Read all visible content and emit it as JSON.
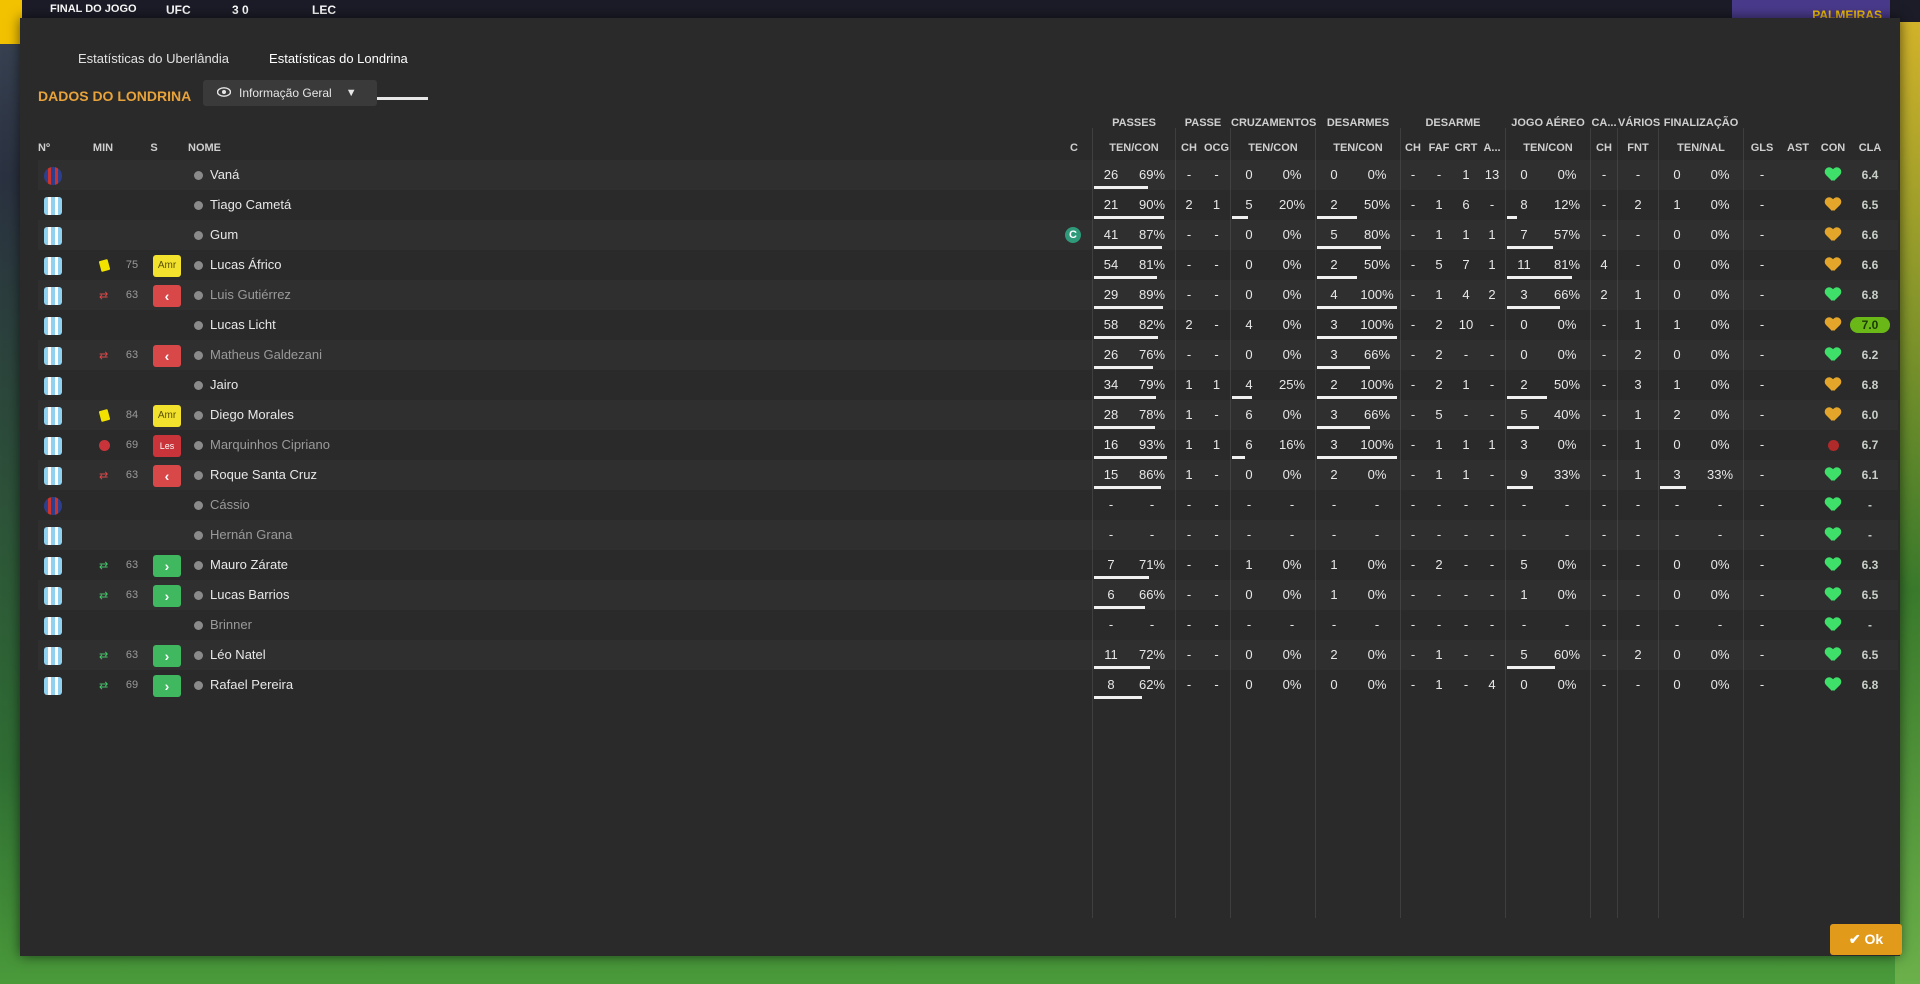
{
  "scorebar": {
    "final": "FINAL DO JOGO",
    "team_a": "UFC",
    "score": "3 0",
    "team_b": "LEC",
    "right_label": "PALMEIRAS"
  },
  "tabs": [
    "Estatísticas do Uberlândia",
    "Estatísticas do Londrina"
  ],
  "active_tab": 1,
  "section_title": "DADOS DO LONDRINA",
  "view_select": {
    "label": "Informação Geral",
    "icon": "eye-icon"
  },
  "groups": {
    "passes": "PASSES",
    "passe": "PASSE",
    "cruzamentos": "CRUZAMENTOS",
    "desarmes": "DESARMES",
    "desarme": "DESARME",
    "jogo_aereo": "JOGO AÉREO",
    "ca": "CA...",
    "varios": "VÁRIOS",
    "finalizacao": "FINALIZAÇÃO"
  },
  "headers": {
    "num": "Nº",
    "min": "MIN",
    "s": "S",
    "name": "NOME",
    "c": "C",
    "pass_tc": "TEN/CON",
    "passe_ch": "CH",
    "passe_ocg": "OCG",
    "cruz_tc": "TEN/CON",
    "des_tc": "TEN/CON",
    "d_ch": "CH",
    "d_faf": "FAF",
    "d_crt": "CRT",
    "d_a": "A...",
    "ja_tc": "TEN/CON",
    "ca_ch": "CH",
    "fnt": "FNT",
    "fin_tn": "TEN/NAL",
    "gls": "GLS",
    "ast": "AST",
    "con": "CON",
    "cla": "CLA"
  },
  "players": [
    {
      "gk": true,
      "min": "",
      "name": "Vaná",
      "cap": "",
      "p": [
        "26",
        "69%"
      ],
      "pbar": 0.69,
      "ch": "-",
      "ocg": "-",
      "cr": [
        "0",
        "0%"
      ],
      "crbar": 0,
      "de": [
        "0",
        "0%"
      ],
      "debar": 0,
      "d": [
        "-",
        "-",
        "1",
        "13"
      ],
      "ja": [
        "0",
        "0%"
      ],
      "jabar": 0,
      "cach": "-",
      "fnt": "-",
      "fi": [
        "0",
        "0%"
      ],
      "fibar": 0,
      "gls": "-",
      "ast": "",
      "con": "g",
      "cla": "6.4",
      "sub": false
    },
    {
      "gk": false,
      "min": "",
      "name": "Tiago Cametá",
      "cap": "",
      "p": [
        "21",
        "90%"
      ],
      "pbar": 0.9,
      "ch": "2",
      "ocg": "1",
      "cr": [
        "5",
        "20%"
      ],
      "crbar": 0.2,
      "de": [
        "2",
        "50%"
      ],
      "debar": 0.5,
      "d": [
        "-",
        "1",
        "6",
        "-"
      ],
      "ja": [
        "8",
        "12%"
      ],
      "jabar": 0.12,
      "cach": "-",
      "fnt": "2",
      "fi": [
        "1",
        "0%"
      ],
      "fibar": 0,
      "gls": "-",
      "ast": "",
      "con": "y",
      "cla": "6.5",
      "sub": false
    },
    {
      "gk": false,
      "min": "",
      "name": "Gum",
      "cap": "C",
      "p": [
        "41",
        "87%"
      ],
      "pbar": 0.87,
      "ch": "-",
      "ocg": "-",
      "cr": [
        "0",
        "0%"
      ],
      "crbar": 0,
      "de": [
        "5",
        "80%"
      ],
      "debar": 0.8,
      "d": [
        "-",
        "1",
        "1",
        "1"
      ],
      "ja": [
        "7",
        "57%"
      ],
      "jabar": 0.57,
      "cach": "-",
      "fnt": "-",
      "fi": [
        "0",
        "0%"
      ],
      "fibar": 0,
      "gls": "-",
      "ast": "",
      "con": "y",
      "cla": "6.6",
      "sub": false
    },
    {
      "gk": false,
      "min": "75",
      "name": "Lucas Áfrico",
      "cap": "",
      "card": "yellow",
      "badge": "Amr",
      "p": [
        "54",
        "81%"
      ],
      "pbar": 0.81,
      "ch": "-",
      "ocg": "-",
      "cr": [
        "0",
        "0%"
      ],
      "crbar": 0,
      "de": [
        "2",
        "50%"
      ],
      "debar": 0.5,
      "d": [
        "-",
        "5",
        "7",
        "1"
      ],
      "ja": [
        "11",
        "81%"
      ],
      "jabar": 0.81,
      "cach": "4",
      "fnt": "-",
      "fi": [
        "0",
        "0%"
      ],
      "fibar": 0,
      "gls": "-",
      "ast": "",
      "con": "y",
      "cla": "6.6",
      "sub": false
    },
    {
      "gk": false,
      "min": "63",
      "name": "Luis Gutiérrez",
      "cap": "",
      "subout": true,
      "p": [
        "29",
        "89%"
      ],
      "pbar": 0.89,
      "ch": "-",
      "ocg": "-",
      "cr": [
        "0",
        "0%"
      ],
      "crbar": 0,
      "de": [
        "4",
        "100%"
      ],
      "debar": 1,
      "d": [
        "-",
        "1",
        "4",
        "2"
      ],
      "ja": [
        "3",
        "66%"
      ],
      "jabar": 0.66,
      "cach": "2",
      "fnt": "1",
      "fi": [
        "0",
        "0%"
      ],
      "fibar": 0,
      "gls": "-",
      "ast": "",
      "con": "g",
      "cla": "6.8",
      "sub": true
    },
    {
      "gk": false,
      "min": "",
      "name": "Lucas Licht",
      "cap": "",
      "p": [
        "58",
        "82%"
      ],
      "pbar": 0.82,
      "ch": "2",
      "ocg": "-",
      "cr": [
        "4",
        "0%"
      ],
      "crbar": 0,
      "de": [
        "3",
        "100%"
      ],
      "debar": 1,
      "d": [
        "-",
        "2",
        "10",
        "-"
      ],
      "ja": [
        "0",
        "0%"
      ],
      "jabar": 0,
      "cach": "-",
      "fnt": "1",
      "fi": [
        "1",
        "0%"
      ],
      "fibar": 0,
      "gls": "-",
      "ast": "",
      "con": "y",
      "cla": "7.0",
      "hi": true,
      "sub": false
    },
    {
      "gk": false,
      "min": "63",
      "name": "Matheus Galdezani",
      "cap": "",
      "subout": true,
      "p": [
        "26",
        "76%"
      ],
      "pbar": 0.76,
      "ch": "-",
      "ocg": "-",
      "cr": [
        "0",
        "0%"
      ],
      "crbar": 0,
      "de": [
        "3",
        "66%"
      ],
      "debar": 0.66,
      "d": [
        "-",
        "2",
        "-",
        "-"
      ],
      "ja": [
        "0",
        "0%"
      ],
      "jabar": 0,
      "cach": "-",
      "fnt": "2",
      "fi": [
        "0",
        "0%"
      ],
      "fibar": 0,
      "gls": "-",
      "ast": "",
      "con": "g",
      "cla": "6.2",
      "sub": true
    },
    {
      "gk": false,
      "min": "",
      "name": "Jairo",
      "cap": "",
      "p": [
        "34",
        "79%"
      ],
      "pbar": 0.79,
      "ch": "1",
      "ocg": "1",
      "cr": [
        "4",
        "25%"
      ],
      "crbar": 0.25,
      "de": [
        "2",
        "100%"
      ],
      "debar": 1,
      "d": [
        "-",
        "2",
        "1",
        "-"
      ],
      "ja": [
        "2",
        "50%"
      ],
      "jabar": 0.5,
      "cach": "-",
      "fnt": "3",
      "fi": [
        "1",
        "0%"
      ],
      "fibar": 0,
      "gls": "-",
      "ast": "",
      "con": "y",
      "cla": "6.8",
      "sub": false
    },
    {
      "gk": false,
      "min": "84",
      "name": "Diego Morales",
      "cap": "",
      "card": "yellow",
      "badge": "Amr",
      "p": [
        "28",
        "78%"
      ],
      "pbar": 0.78,
      "ch": "1",
      "ocg": "-",
      "cr": [
        "6",
        "0%"
      ],
      "crbar": 0,
      "de": [
        "3",
        "66%"
      ],
      "debar": 0.66,
      "d": [
        "-",
        "5",
        "-",
        "-"
      ],
      "ja": [
        "5",
        "40%"
      ],
      "jabar": 0.4,
      "cach": "-",
      "fnt": "1",
      "fi": [
        "2",
        "0%"
      ],
      "fibar": 0,
      "gls": "-",
      "ast": "",
      "con": "y",
      "cla": "6.0",
      "sub": false
    },
    {
      "gk": false,
      "min": "69",
      "name": "Marquinhos Cipriano",
      "cap": "",
      "card": "injury",
      "badge": "Les",
      "p": [
        "16",
        "93%"
      ],
      "pbar": 0.93,
      "ch": "1",
      "ocg": "1",
      "cr": [
        "6",
        "16%"
      ],
      "crbar": 0.16,
      "de": [
        "3",
        "100%"
      ],
      "debar": 1,
      "d": [
        "-",
        "1",
        "1",
        "1"
      ],
      "ja": [
        "3",
        "0%"
      ],
      "jabar": 0,
      "cach": "-",
      "fnt": "1",
      "fi": [
        "0",
        "0%"
      ],
      "fibar": 0,
      "gls": "-",
      "ast": "",
      "con": "inj",
      "cla": "6.7",
      "sub": true
    },
    {
      "gk": false,
      "min": "63",
      "name": "Roque Santa Cruz",
      "cap": "",
      "subout": true,
      "p": [
        "15",
        "86%"
      ],
      "pbar": 0.86,
      "ch": "1",
      "ocg": "-",
      "cr": [
        "0",
        "0%"
      ],
      "crbar": 0,
      "de": [
        "2",
        "0%"
      ],
      "debar": 0,
      "d": [
        "-",
        "1",
        "1",
        "-"
      ],
      "ja": [
        "9",
        "33%"
      ],
      "jabar": 0.33,
      "cach": "-",
      "fnt": "1",
      "fi": [
        "3",
        "33%"
      ],
      "fibar": 0.33,
      "gls": "-",
      "ast": "",
      "con": "g",
      "cla": "6.1",
      "sub": false
    },
    {
      "gk": true,
      "min": "",
      "name": "Cássio",
      "cap": "",
      "p": [
        "-",
        "-"
      ],
      "pbar": 0,
      "ch": "-",
      "ocg": "-",
      "cr": [
        "-",
        "-"
      ],
      "crbar": 0,
      "de": [
        "-",
        "-"
      ],
      "debar": 0,
      "d": [
        "-",
        "-",
        "-",
        "-"
      ],
      "ja": [
        "-",
        "-"
      ],
      "jabar": 0,
      "cach": "-",
      "fnt": "-",
      "fi": [
        "-",
        "-"
      ],
      "fibar": 0,
      "gls": "-",
      "ast": "",
      "con": "g",
      "cla": "-",
      "sub": true
    },
    {
      "gk": false,
      "min": "",
      "name": "Hernán Grana",
      "cap": "",
      "p": [
        "-",
        "-"
      ],
      "pbar": 0,
      "ch": "-",
      "ocg": "-",
      "cr": [
        "-",
        "-"
      ],
      "crbar": 0,
      "de": [
        "-",
        "-"
      ],
      "debar": 0,
      "d": [
        "-",
        "-",
        "-",
        "-"
      ],
      "ja": [
        "-",
        "-"
      ],
      "jabar": 0,
      "cach": "-",
      "fnt": "-",
      "fi": [
        "-",
        "-"
      ],
      "fibar": 0,
      "gls": "-",
      "ast": "",
      "con": "g",
      "cla": "-",
      "sub": true
    },
    {
      "gk": false,
      "min": "63",
      "name": "Mauro Zárate",
      "cap": "",
      "subin": true,
      "p": [
        "7",
        "71%"
      ],
      "pbar": 0.71,
      "ch": "-",
      "ocg": "-",
      "cr": [
        "1",
        "0%"
      ],
      "crbar": 0,
      "de": [
        "1",
        "0%"
      ],
      "debar": 0,
      "d": [
        "-",
        "2",
        "-",
        "-"
      ],
      "ja": [
        "5",
        "0%"
      ],
      "jabar": 0,
      "cach": "-",
      "fnt": "-",
      "fi": [
        "0",
        "0%"
      ],
      "fibar": 0,
      "gls": "-",
      "ast": "",
      "con": "g",
      "cla": "6.3",
      "sub": false
    },
    {
      "gk": false,
      "min": "63",
      "name": "Lucas Barrios",
      "cap": "",
      "subin": true,
      "p": [
        "6",
        "66%"
      ],
      "pbar": 0.66,
      "ch": "-",
      "ocg": "-",
      "cr": [
        "0",
        "0%"
      ],
      "crbar": 0,
      "de": [
        "1",
        "0%"
      ],
      "debar": 0,
      "d": [
        "-",
        "-",
        "-",
        "-"
      ],
      "ja": [
        "1",
        "0%"
      ],
      "jabar": 0,
      "cach": "-",
      "fnt": "-",
      "fi": [
        "0",
        "0%"
      ],
      "fibar": 0,
      "gls": "-",
      "ast": "",
      "con": "g",
      "cla": "6.5",
      "sub": false
    },
    {
      "gk": false,
      "min": "",
      "name": "Brinner",
      "cap": "",
      "p": [
        "-",
        "-"
      ],
      "pbar": 0,
      "ch": "-",
      "ocg": "-",
      "cr": [
        "-",
        "-"
      ],
      "crbar": 0,
      "de": [
        "-",
        "-"
      ],
      "debar": 0,
      "d": [
        "-",
        "-",
        "-",
        "-"
      ],
      "ja": [
        "-",
        "-"
      ],
      "jabar": 0,
      "cach": "-",
      "fnt": "-",
      "fi": [
        "-",
        "-"
      ],
      "fibar": 0,
      "gls": "-",
      "ast": "",
      "con": "g",
      "cla": "-",
      "sub": true
    },
    {
      "gk": false,
      "min": "63",
      "name": "Léo Natel",
      "cap": "",
      "subin": true,
      "p": [
        "11",
        "72%"
      ],
      "pbar": 0.72,
      "ch": "-",
      "ocg": "-",
      "cr": [
        "0",
        "0%"
      ],
      "crbar": 0,
      "de": [
        "2",
        "0%"
      ],
      "debar": 0,
      "d": [
        "-",
        "1",
        "-",
        "-"
      ],
      "ja": [
        "5",
        "60%"
      ],
      "jabar": 0.6,
      "cach": "-",
      "fnt": "2",
      "fi": [
        "0",
        "0%"
      ],
      "fibar": 0,
      "gls": "-",
      "ast": "",
      "con": "g",
      "cla": "6.5",
      "sub": false
    },
    {
      "gk": false,
      "min": "69",
      "name": "Rafael Pereira",
      "cap": "",
      "subin": true,
      "p": [
        "8",
        "62%"
      ],
      "pbar": 0.62,
      "ch": "-",
      "ocg": "-",
      "cr": [
        "0",
        "0%"
      ],
      "crbar": 0,
      "de": [
        "0",
        "0%"
      ],
      "debar": 0,
      "d": [
        "-",
        "1",
        "-",
        "4"
      ],
      "ja": [
        "0",
        "0%"
      ],
      "jabar": 0,
      "cach": "-",
      "fnt": "-",
      "fi": [
        "0",
        "0%"
      ],
      "fibar": 0,
      "gls": "-",
      "ast": "",
      "con": "g",
      "cla": "6.8",
      "sub": false
    }
  ],
  "ok_label": "Ok",
  "colors": {
    "accent": "#e8a33a",
    "ok": "#e29a1a",
    "panel": "#2a2a2a"
  }
}
